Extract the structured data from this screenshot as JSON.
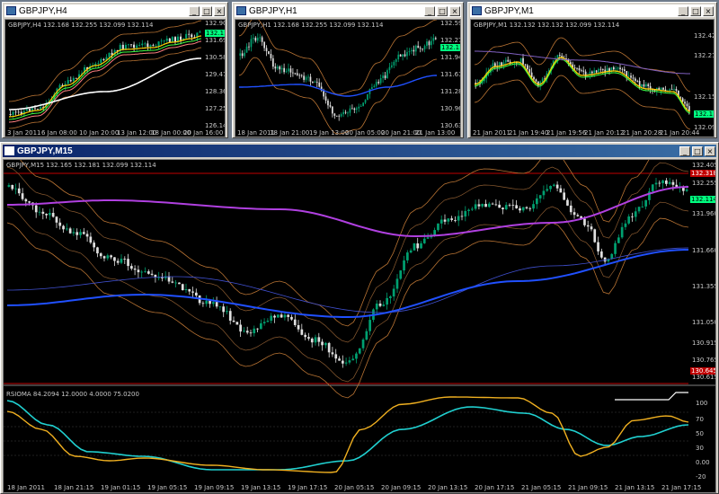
{
  "colors": {
    "bull": "#00a070",
    "bear": "#e0e0e0",
    "bb": "#b87333",
    "ma_blue": "#2050ff",
    "ma_purple": "#b040e0",
    "rsi_cyan": "#20d0d0",
    "rsi_gold": "#f0b020",
    "price_up": "#00ff80",
    "price_red": "#c00000"
  },
  "windows": [
    {
      "title": "GBPJPY,H4",
      "info": "GBPJPY,H4 132.168 132.255 132.099 132.114",
      "y_labels": [
        "132.900",
        "131.690",
        "130.580",
        "129.470",
        "128.360",
        "127.250",
        "126.140"
      ],
      "x_labels": [
        "3 Jan 2011",
        "6 Jan 08:00",
        "10 Jan 20:00",
        "13 Jan 12:00",
        "18 Jan 00:00",
        "20 Jan 16:00"
      ],
      "price": "132.114"
    },
    {
      "title": "GBPJPY,H1",
      "info": "GBPJPY,H1 132.168 132.255 132.099 132.114",
      "y_labels": [
        "132.590",
        "132.270",
        "131.940",
        "131.610",
        "131.280",
        "130.960",
        "130.630"
      ],
      "x_labels": [
        "18 Jan 2011",
        "18 Jan 21:00",
        "19 Jan 13:00",
        "20 Jan 05:00",
        "20 Jan 21:00",
        "21 Jan 13:00"
      ],
      "price": "132.114"
    },
    {
      "title": "GBPJPY,M1",
      "info": "GBPJPY,M1 132.132 132.132 132.099 132.114",
      "y_labels": [
        "132.420",
        "132.215",
        "132.150",
        "132.095"
      ],
      "x_labels": [
        "21 Jan 2011",
        "21 Jan 19:40",
        "21 Jan 19:56",
        "21 Jan 20:12",
        "21 Jan 20:28",
        "21 Jan 20:44"
      ],
      "price": "132.114"
    },
    {
      "title": "GBPJPY,M15",
      "info": "GBPJPY,M15 132.165 132.181 132.099 132.114",
      "y_labels": [
        "132.405",
        "132.255",
        "131.960",
        "131.660",
        "131.355",
        "131.050",
        "130.915",
        "130.765",
        "130.615"
      ],
      "x_labels": [
        "18 Jan 2011",
        "18 Jan 21:15",
        "19 Jan 01:15",
        "19 Jan 05:15",
        "19 Jan 09:15",
        "19 Jan 13:15",
        "19 Jan 17:15",
        "20 Jan 05:15",
        "20 Jan 09:15",
        "20 Jan 13:15",
        "20 Jan 17:15",
        "21 Jan 05:15",
        "21 Jan 09:15",
        "21 Jan 13:15",
        "21 Jan 17:15"
      ],
      "price": "132.114",
      "price_top": "132.318",
      "price_bottom": "130.645",
      "rsi_info": "RSIOMA 84.2094 12.0000 4.0000 75.0200",
      "rsi_labels": [
        "100",
        "70",
        "50",
        "30",
        "0.00",
        "-20"
      ]
    }
  ]
}
